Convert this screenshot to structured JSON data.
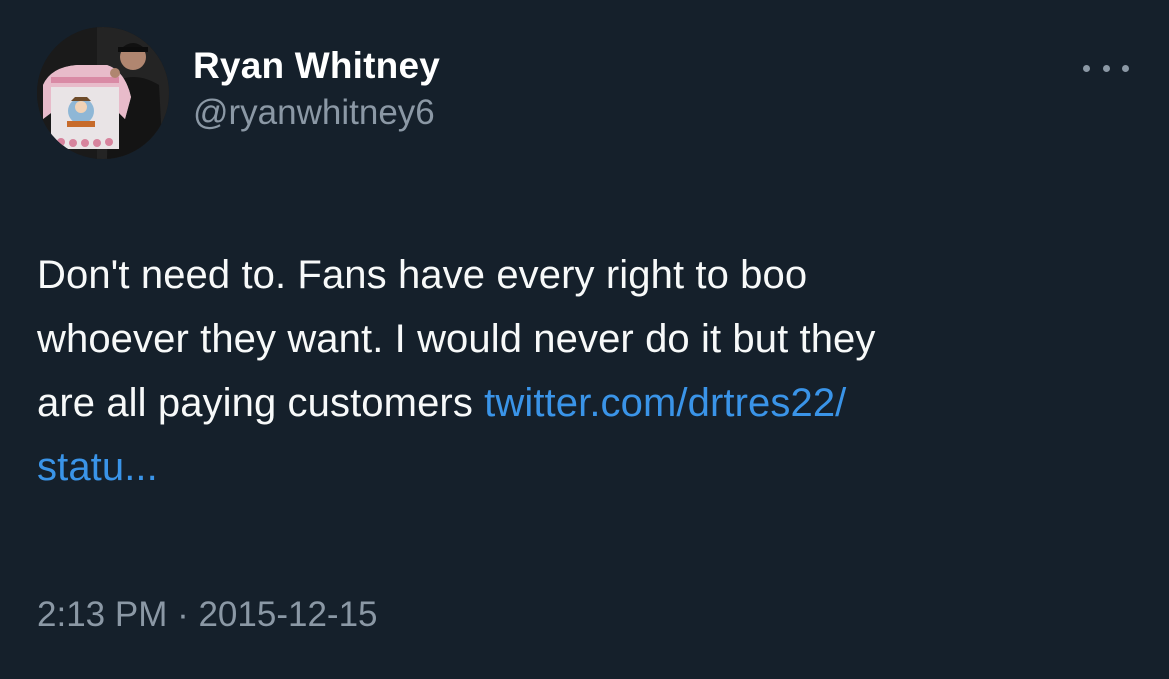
{
  "author": {
    "display_name": "Ryan Whitney",
    "handle": "@ryanwhitney6",
    "avatar_icon": "profile-photo-icon"
  },
  "menu": {
    "more_icon": "more-horizontal-icon"
  },
  "tweet": {
    "text_line_1": "Don't need to. Fans have every right to boo",
    "text_line_2": "whoever they want. I would never do it but they",
    "text_line_3": "are all paying customers ",
    "link_part_1": "twitter.com/drtres22/",
    "link_part_2": "statu..."
  },
  "meta": {
    "time": "2:13 PM",
    "separator": " · ",
    "date": "2015-12-15"
  },
  "colors": {
    "background": "#15202b",
    "text": "#f7f9f9",
    "secondary": "#8b98a5",
    "link": "#3a94e8"
  }
}
